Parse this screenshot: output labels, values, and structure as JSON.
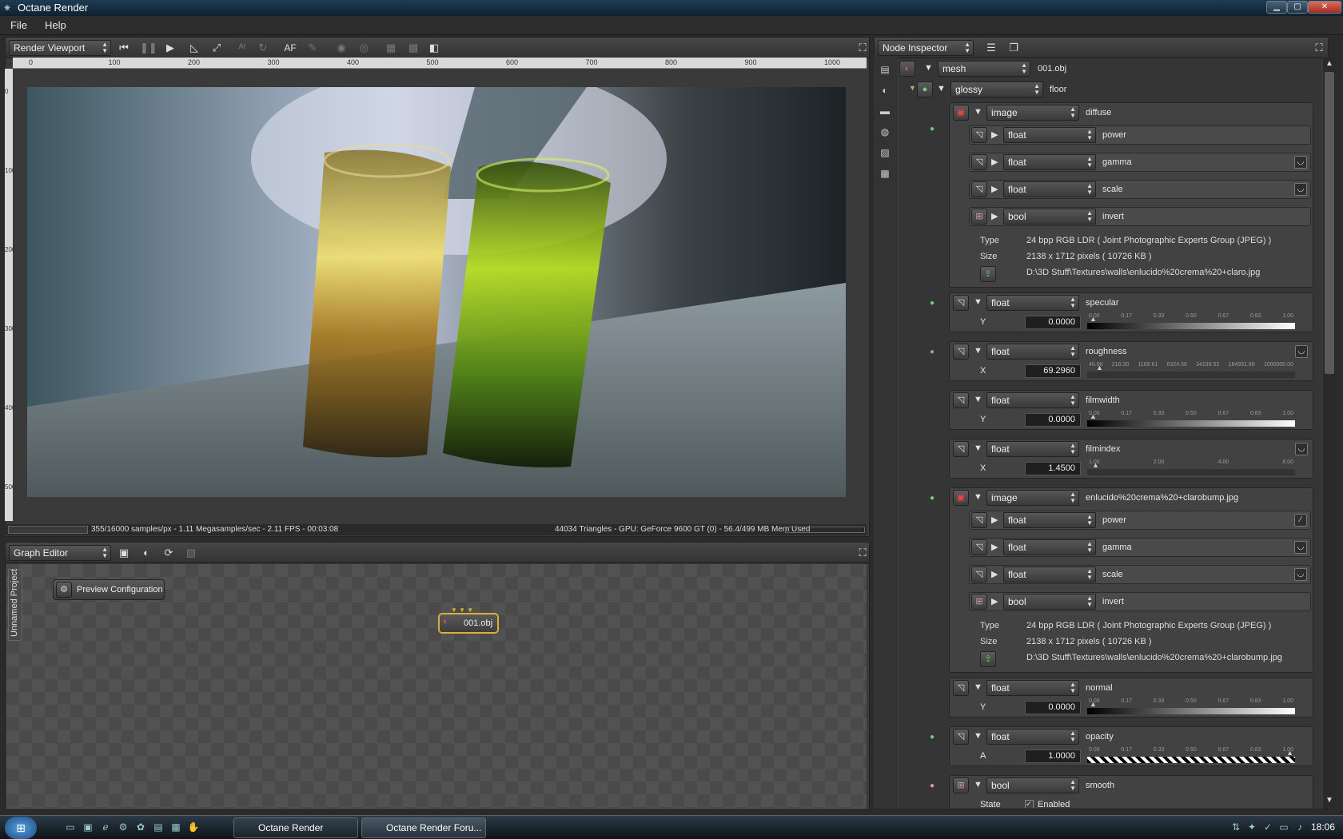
{
  "window": {
    "title": "Octane Render"
  },
  "menu": [
    "File",
    "Help"
  ],
  "viewport": {
    "panel_select": "Render Viewport",
    "af_label": "AF",
    "ruler_h": [
      "0",
      "100",
      "200",
      "300",
      "400",
      "500",
      "600",
      "700",
      "800",
      "900",
      "1000"
    ],
    "ruler_v": [
      "0",
      "100",
      "200",
      "300",
      "400",
      "500"
    ],
    "status_left": "355/16000 samples/px - 1.11 Megasamples/sec - 2.11 FPS - 00:03:08",
    "status_right": "44034 Triangles - GPU: GeForce 9600 GT (0) - 56.4/499 MB Mem Used"
  },
  "graph": {
    "panel_select": "Graph Editor",
    "side_tab": "Unnamed Project",
    "preview_node": "Preview Configuration",
    "mesh_node": "001.obj"
  },
  "inspector": {
    "panel_select": "Node Inspector",
    "mesh_type": "mesh",
    "mesh_name": "001.obj",
    "mat_type": "glossy",
    "mat_name": "floor",
    "diffuse": {
      "type": "image",
      "name": "diffuse",
      "params": [
        {
          "type": "float",
          "name": "power"
        },
        {
          "type": "float",
          "name": "gamma"
        },
        {
          "type": "float",
          "name": "scale"
        },
        {
          "type": "bool",
          "name": "invert"
        }
      ],
      "type_label": "Type",
      "type_value": "24 bpp RGB LDR ( Joint Photographic Experts Group (JPEG) )",
      "size_label": "Size",
      "size_value": "2138 x 1712 pixels ( 10726 KB )",
      "path": "D:\\3D Stuff\\Textures\\walls\\enlucido%20crema%20+claro.jpg"
    },
    "specular": {
      "type": "float",
      "name": "specular",
      "axis": "Y",
      "value": "0.0000",
      "marks": [
        "0.00",
        "0.17",
        "0.33",
        "0.50",
        "0.67",
        "0.83",
        "1.00"
      ]
    },
    "roughness": {
      "type": "float",
      "name": "roughness",
      "axis": "X",
      "value": "69.2960",
      "marks": [
        "40.00",
        "216.30",
        "1169.61",
        "6324.56",
        "34199.52",
        "184931.80",
        "1000000.00"
      ]
    },
    "filmwidth": {
      "type": "float",
      "name": "filmwidth",
      "axis": "Y",
      "value": "0.0000",
      "marks": [
        "0.00",
        "0.17",
        "0.33",
        "0.50",
        "0.67",
        "0.83",
        "1.00"
      ]
    },
    "filmindex": {
      "type": "float",
      "name": "filmindex",
      "axis": "X",
      "value": "1.4500",
      "marks": [
        "1.00",
        "2.00",
        "4.00",
        "8.00"
      ]
    },
    "bump": {
      "type": "image",
      "name": "enlucido%20crema%20+clarobump.jpg",
      "params": [
        {
          "type": "float",
          "name": "power"
        },
        {
          "type": "float",
          "name": "gamma"
        },
        {
          "type": "float",
          "name": "scale"
        },
        {
          "type": "bool",
          "name": "invert"
        }
      ],
      "type_label": "Type",
      "type_value": "24 bpp RGB LDR ( Joint Photographic Experts Group (JPEG) )",
      "size_label": "Size",
      "size_value": "2138 x 1712 pixels ( 10726 KB )",
      "path": "D:\\3D Stuff\\Textures\\walls\\enlucido%20crema%20+clarobump.jpg"
    },
    "normal": {
      "type": "float",
      "name": "normal",
      "axis": "Y",
      "value": "0.0000",
      "marks": [
        "0.00",
        "0.17",
        "0.33",
        "0.50",
        "0.67",
        "0.83",
        "1.00"
      ]
    },
    "opacity": {
      "type": "float",
      "name": "opacity",
      "axis": "A",
      "value": "1.0000",
      "marks": [
        "0.00",
        "0.17",
        "0.33",
        "0.50",
        "0.67",
        "0.83",
        "1.00"
      ]
    },
    "smooth": {
      "type": "bool",
      "name": "smooth",
      "state_label": "State",
      "state_value": "Enabled"
    }
  },
  "taskbar": {
    "buttons": [
      "Octane Render",
      "Octane Render Foru..."
    ],
    "clock": "18:06"
  },
  "colors": {
    "accent": "#d8b040",
    "window_title": "#1f3b52"
  }
}
